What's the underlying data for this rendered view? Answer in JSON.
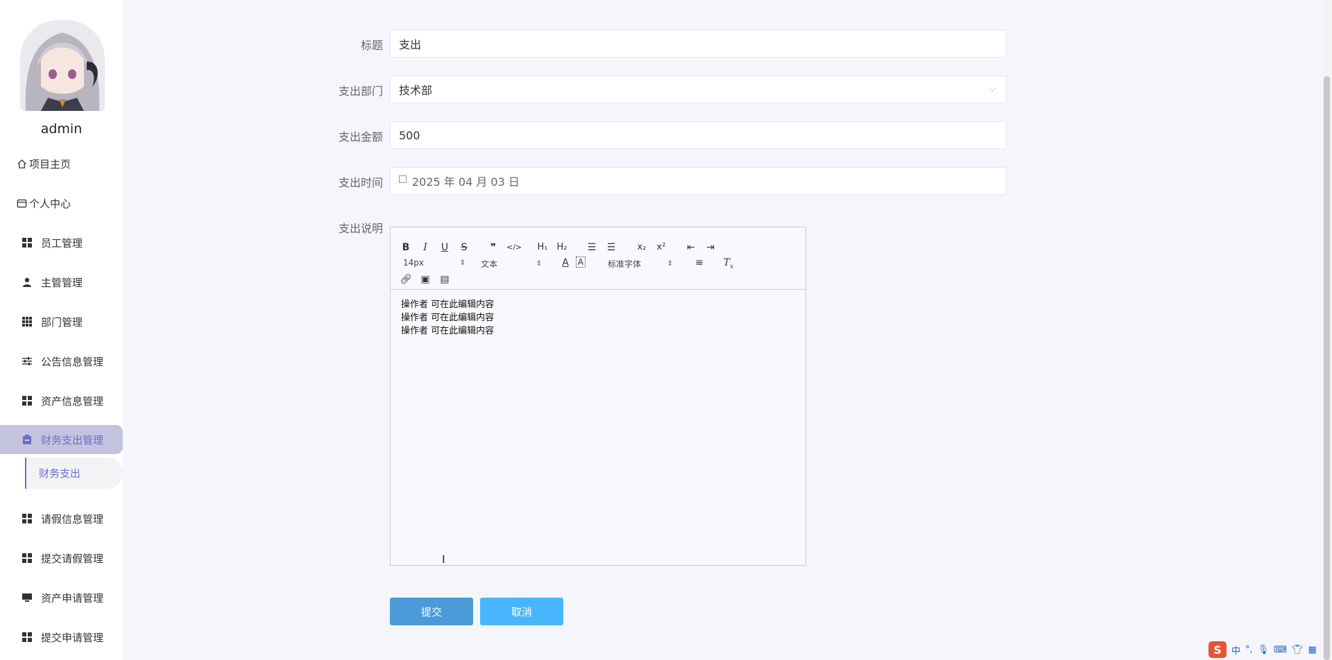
{
  "sidebar": {
    "username": "admin",
    "items": [
      {
        "label": "项目主页",
        "icon": "home-icon"
      },
      {
        "label": "个人中心",
        "icon": "card-icon"
      },
      {
        "label": "员工管理",
        "icon": "grid-icon"
      },
      {
        "label": "主管管理",
        "icon": "user-icon"
      },
      {
        "label": "部门管理",
        "icon": "apps-icon"
      },
      {
        "label": "公告信息管理",
        "icon": "sliders-icon"
      },
      {
        "label": "资产信息管理",
        "icon": "grid-icon"
      },
      {
        "label": "财务支出管理",
        "icon": "clipboard-icon"
      },
      {
        "label": "请假信息管理",
        "icon": "grid-icon"
      },
      {
        "label": "提交请假管理",
        "icon": "grid-icon"
      },
      {
        "label": "资产申请管理",
        "icon": "monitor-icon"
      },
      {
        "label": "提交申请管理",
        "icon": "grid-icon"
      }
    ],
    "sub_item": "财务支出",
    "active_color": "#6d6cd1"
  },
  "form": {
    "title_label": "标题",
    "title_value": "支出",
    "dept_label": "支出部门",
    "dept_value": "技术部",
    "amount_label": "支出金额",
    "amount_value": "500",
    "time_label": "支出时间",
    "time_value": "2025 年 04 月 03 日",
    "desc_label": "支出说明"
  },
  "editor": {
    "font_size": "14px",
    "format": "文本",
    "font_family": "标准字体",
    "lines": [
      "操作者  可在此编辑内容",
      "操作者  可在此编辑内容",
      "操作者  可在此编辑内容"
    ]
  },
  "buttons": {
    "submit": "提交",
    "cancel": "取消"
  },
  "ime": {
    "logo": "S",
    "mode": "中"
  }
}
